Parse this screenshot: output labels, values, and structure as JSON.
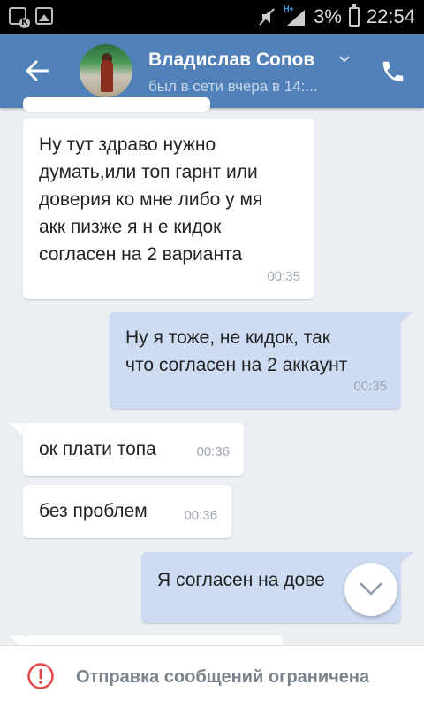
{
  "statusbar": {
    "battery_percent": "3%",
    "time": "22:54",
    "network": "H+"
  },
  "header": {
    "name": "Владислав Сопов",
    "status": "был в сети вчера в 14:..."
  },
  "messages": [
    {
      "dir": "in",
      "text_lines": [
        "Ну тут здраво нужно",
        "думать,или топ гарнт или",
        "доверия ко мне либо у мя",
        "акк пизже я н е кидок",
        "согласен на 2 варианта"
      ],
      "time": "00:35"
    },
    {
      "dir": "out",
      "text_lines": [
        "Ну я тоже, не кидок, так",
        "что согласен на 2 аккаунт"
      ],
      "time": "00:35"
    },
    {
      "dir": "in",
      "text_lines": [
        "ок плати топа"
      ],
      "time": "00:36"
    },
    {
      "dir": "in",
      "text_lines": [
        "без проблем"
      ],
      "time": "00:36"
    },
    {
      "dir": "out",
      "text_lines": [
        "Я согласен на дове"
      ],
      "time": ""
    }
  ],
  "footer": {
    "text": "Отправка сообщений ограничена"
  },
  "colors": {
    "header": "#5181b8",
    "outgoing_bubble": "#cddcf2",
    "background": "#ebeef2",
    "warning": "#e64646"
  }
}
